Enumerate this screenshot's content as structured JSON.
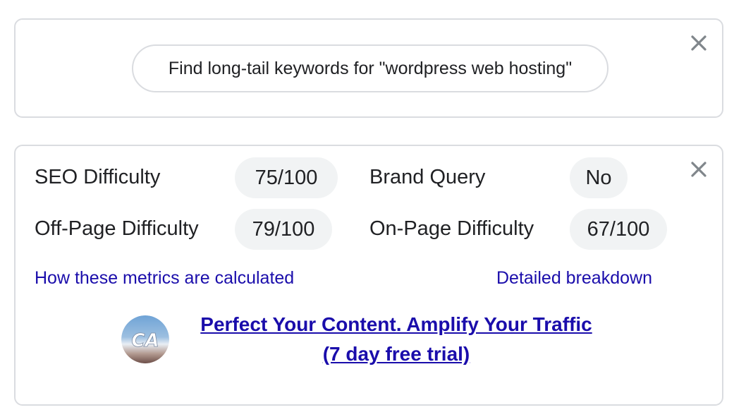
{
  "query_card": {
    "query_text": "Find long-tail keywords for \"wordpress web hosting\""
  },
  "metrics_card": {
    "metrics": [
      {
        "label": "SEO Difficulty",
        "value": "75/100"
      },
      {
        "label": "Brand Query",
        "value": "No"
      },
      {
        "label": "Off-Page Difficulty",
        "value": "79/100"
      },
      {
        "label": "On-Page Difficulty",
        "value": "67/100"
      }
    ],
    "how_calculated_link": "How these metrics are calculated",
    "breakdown_link": "Detailed breakdown",
    "promo": {
      "avatar_text": "CA",
      "line1": "Perfect Your Content. Amplify Your Traffic",
      "line2": "(7 day free trial)"
    }
  },
  "icons": {
    "close": "close-icon",
    "avatar": "ca-logo-avatar"
  },
  "colors": {
    "link": "#1a0dab",
    "pill_bg": "#f1f3f4",
    "border": "#dadce0",
    "close_icon": "#80868b"
  }
}
